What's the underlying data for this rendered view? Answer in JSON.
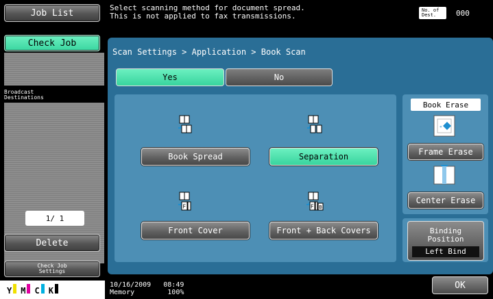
{
  "left_panel": {
    "job_list": "Job List",
    "check_job": "Check Job",
    "broadcast_destinations": "Broadcast\nDestinations",
    "page_count": "1/ 1",
    "delete": "Delete",
    "check_job_settings": "Check Job\nSettings",
    "toner": [
      {
        "label": "Y",
        "color": "#f0e000"
      },
      {
        "label": "M",
        "color": "#e000a0"
      },
      {
        "label": "C",
        "color": "#00b0e0"
      },
      {
        "label": "K",
        "color": "#000000"
      }
    ]
  },
  "header": {
    "message": "Select scanning method for document spread.\nThis is not applied to fax transmissions.",
    "dest_label": "No. of\nDest.",
    "dest_count": "000"
  },
  "main": {
    "breadcrumb": "Scan Settings > Application > Book Scan",
    "toggle": {
      "yes": "Yes",
      "no": "No",
      "selected": "Yes"
    },
    "methods": {
      "book_spread": "Book Spread",
      "separation": "Separation",
      "front_cover": "Front Cover",
      "front_back_covers": "Front + Back Covers",
      "selected": "Separation"
    },
    "book_erase": {
      "title": "Book Erase",
      "frame_erase": "Frame Erase",
      "center_erase": "Center Erase"
    },
    "binding": {
      "label": "Binding\nPosition",
      "value": "Left Bind"
    }
  },
  "status": {
    "datetime": "10/16/2009   08:49",
    "memory": "Memory        100%"
  },
  "ok": "OK",
  "colors": {
    "accent_green": "#3ad6a0",
    "panel_blue": "#2a6e96",
    "area_blue": "#4d8fb5"
  }
}
